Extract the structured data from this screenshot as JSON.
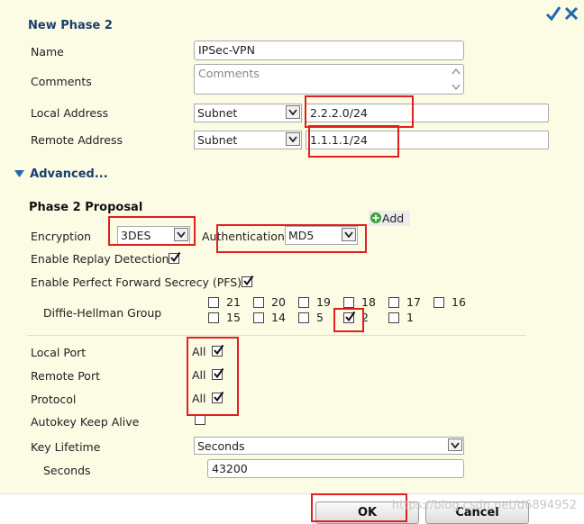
{
  "header": {
    "title": "New Phase 2"
  },
  "form": {
    "name_label": "Name",
    "name_value": "IPSec-VPN",
    "comments_label": "Comments",
    "comments_placeholder": "Comments",
    "local_address_label": "Local Address",
    "local_address_type": "Subnet",
    "local_address_value": "2.2.2.0/24",
    "remote_address_label": "Remote Address",
    "remote_address_type": "Subnet",
    "remote_address_value": "1.1.1.1/24",
    "advanced_label": "Advanced..."
  },
  "proposal": {
    "title": "Phase 2 Proposal",
    "add_label": "Add",
    "encryption_label": "Encryption",
    "encryption_value": "3DES",
    "authentication_label": "Authentication",
    "authentication_value": "MD5",
    "replay_label": "Enable Replay Detection",
    "replay_checked": true,
    "pfs_label": "Enable Perfect Forward Secrecy (PFS)",
    "pfs_checked": true,
    "dh_label": "Diffie-Hellman Group",
    "dh_groups_row1": [
      {
        "label": "21",
        "checked": false
      },
      {
        "label": "20",
        "checked": false
      },
      {
        "label": "19",
        "checked": false
      },
      {
        "label": "18",
        "checked": false
      },
      {
        "label": "17",
        "checked": false
      },
      {
        "label": "16",
        "checked": false
      }
    ],
    "dh_groups_row2": [
      {
        "label": "15",
        "checked": false
      },
      {
        "label": "14",
        "checked": false
      },
      {
        "label": "5",
        "checked": false
      },
      {
        "label": "2",
        "checked": true
      },
      {
        "label": "1",
        "checked": false
      }
    ]
  },
  "selectors": {
    "local_port_label": "Local Port",
    "local_port_value": "All",
    "remote_port_label": "Remote Port",
    "remote_port_value": "All",
    "protocol_label": "Protocol",
    "protocol_value": "All",
    "autokey_label": "Autokey Keep Alive",
    "autokey_checked": false,
    "key_lifetime_label": "Key Lifetime",
    "key_lifetime_value": "Seconds",
    "seconds_label": "Seconds",
    "seconds_value": "43200"
  },
  "footer": {
    "ok_label": "OK",
    "cancel_label": "Cancel",
    "watermark": "https://blog.csdn.net/d6894952"
  },
  "colors": {
    "panel_bg": "#fcfbe4",
    "title": "#1d3e6e",
    "accent": "#1f6ab0",
    "highlight_red": "#e02020",
    "add_green": "#3aa33a"
  }
}
